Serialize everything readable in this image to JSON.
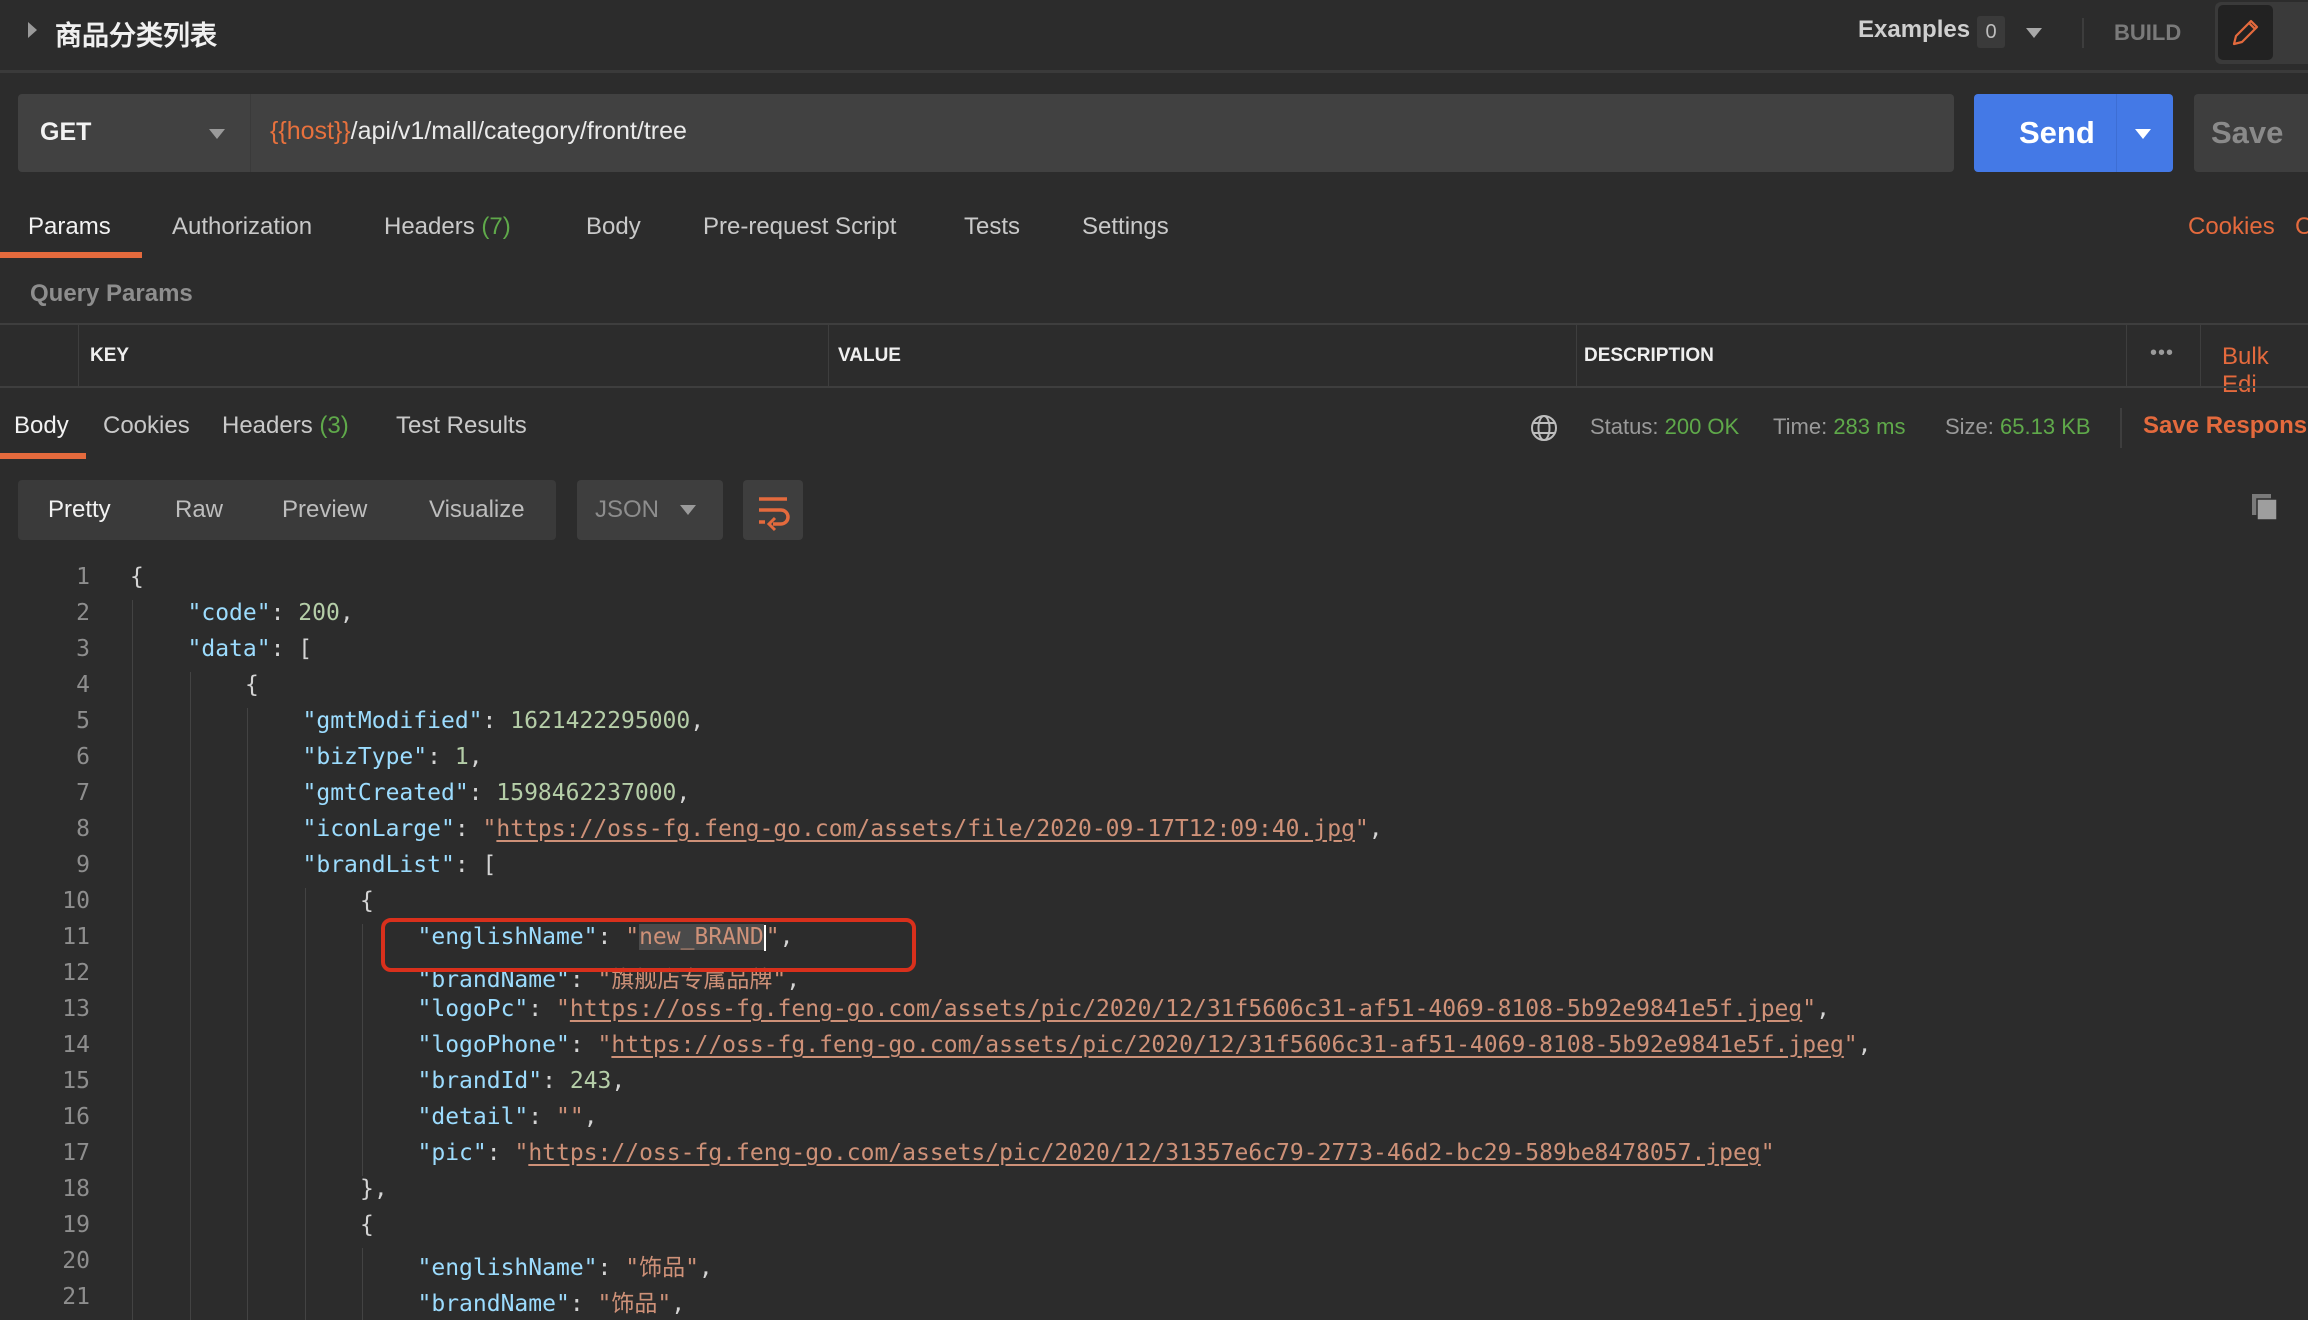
{
  "header": {
    "title": "商品分类列表",
    "examples_label": "Examples",
    "examples_count": "0",
    "build_label": "BUILD"
  },
  "request": {
    "method": "GET",
    "url_variable": "{{host}}",
    "url_path": "/api/v1/mall/category/front/tree",
    "send_label": "Send",
    "save_label": "Save"
  },
  "request_tabs": [
    {
      "label": "Params",
      "count": "",
      "active": true
    },
    {
      "label": "Authorization",
      "count": ""
    },
    {
      "label": "Headers",
      "count": "(7)"
    },
    {
      "label": "Body",
      "count": ""
    },
    {
      "label": "Pre-request Script",
      "count": ""
    },
    {
      "label": "Tests",
      "count": ""
    },
    {
      "label": "Settings",
      "count": ""
    }
  ],
  "request_links": {
    "cookies": "Cookies",
    "code": "C"
  },
  "query_params": {
    "title": "Query Params",
    "columns": [
      "KEY",
      "VALUE",
      "DESCRIPTION"
    ],
    "more": "•••",
    "bulk_edit": "Bulk Edi"
  },
  "response": {
    "tabs": [
      {
        "label": "Body",
        "count": "",
        "active": true
      },
      {
        "label": "Cookies",
        "count": ""
      },
      {
        "label": "Headers",
        "count": "(3)"
      },
      {
        "label": "Test Results",
        "count": ""
      }
    ],
    "status_label": "Status:",
    "status_value": "200 OK",
    "time_label": "Time:",
    "time_value": "283 ms",
    "size_label": "Size:",
    "size_value": "65.13 KB",
    "save_response": "Save Response",
    "view_modes": [
      "Pretty",
      "Raw",
      "Preview",
      "Visualize"
    ],
    "active_view": "Pretty",
    "format": "JSON"
  },
  "code_lines": [
    {
      "n": "1",
      "indent": 0,
      "parts": [
        [
          "p",
          "{"
        ]
      ]
    },
    {
      "n": "2",
      "indent": 1,
      "parts": [
        [
          "k",
          "\"code\""
        ],
        [
          "p",
          ": "
        ],
        [
          "n",
          "200"
        ],
        [
          "p",
          ","
        ]
      ]
    },
    {
      "n": "3",
      "indent": 1,
      "parts": [
        [
          "k",
          "\"data\""
        ],
        [
          "p",
          ": ["
        ]
      ]
    },
    {
      "n": "4",
      "indent": 2,
      "parts": [
        [
          "p",
          "{"
        ]
      ]
    },
    {
      "n": "5",
      "indent": 3,
      "parts": [
        [
          "k",
          "\"gmtModified\""
        ],
        [
          "p",
          ": "
        ],
        [
          "n",
          "1621422295000"
        ],
        [
          "p",
          ","
        ]
      ]
    },
    {
      "n": "6",
      "indent": 3,
      "parts": [
        [
          "k",
          "\"bizType\""
        ],
        [
          "p",
          ": "
        ],
        [
          "n",
          "1"
        ],
        [
          "p",
          ","
        ]
      ]
    },
    {
      "n": "7",
      "indent": 3,
      "parts": [
        [
          "k",
          "\"gmtCreated\""
        ],
        [
          "p",
          ": "
        ],
        [
          "n",
          "1598462237000"
        ],
        [
          "p",
          ","
        ]
      ]
    },
    {
      "n": "8",
      "indent": 3,
      "parts": [
        [
          "k",
          "\"iconLarge\""
        ],
        [
          "p",
          ": "
        ],
        [
          "s",
          "\""
        ],
        [
          "u",
          "https://oss-fg.feng-go.com/assets/file/2020-09-17T12:09:40.jpg"
        ],
        [
          "s",
          "\""
        ],
        [
          "p",
          ","
        ]
      ]
    },
    {
      "n": "9",
      "indent": 3,
      "parts": [
        [
          "k",
          "\"brandList\""
        ],
        [
          "p",
          ": ["
        ]
      ]
    },
    {
      "n": "10",
      "indent": 4,
      "parts": [
        [
          "p",
          "{"
        ]
      ]
    },
    {
      "n": "11",
      "indent": 5,
      "parts": [
        [
          "k",
          "\"englishName\""
        ],
        [
          "p",
          ": "
        ],
        [
          "s",
          "\""
        ],
        [
          "sel",
          "new_BRAND"
        ],
        [
          "cursor",
          ""
        ],
        [
          "s",
          "\""
        ],
        [
          "p",
          ","
        ]
      ]
    },
    {
      "n": "12",
      "indent": 5,
      "parts": [
        [
          "k",
          "\"brandName\""
        ],
        [
          "p",
          ": "
        ],
        [
          "s",
          "\"旗舰店专属品牌\""
        ],
        [
          "p",
          ","
        ]
      ]
    },
    {
      "n": "13",
      "indent": 5,
      "parts": [
        [
          "k",
          "\"logoPc\""
        ],
        [
          "p",
          ": "
        ],
        [
          "s",
          "\""
        ],
        [
          "u",
          "https://oss-fg.feng-go.com/assets/pic/2020/12/31f5606c31-af51-4069-8108-5b92e9841e5f.jpeg"
        ],
        [
          "s",
          "\""
        ],
        [
          "p",
          ","
        ]
      ]
    },
    {
      "n": "14",
      "indent": 5,
      "parts": [
        [
          "k",
          "\"logoPhone\""
        ],
        [
          "p",
          ": "
        ],
        [
          "s",
          "\""
        ],
        [
          "u",
          "https://oss-fg.feng-go.com/assets/pic/2020/12/31f5606c31-af51-4069-8108-5b92e9841e5f.jpeg"
        ],
        [
          "s",
          "\""
        ],
        [
          "p",
          ","
        ]
      ]
    },
    {
      "n": "15",
      "indent": 5,
      "parts": [
        [
          "k",
          "\"brandId\""
        ],
        [
          "p",
          ": "
        ],
        [
          "n",
          "243"
        ],
        [
          "p",
          ","
        ]
      ]
    },
    {
      "n": "16",
      "indent": 5,
      "parts": [
        [
          "k",
          "\"detail\""
        ],
        [
          "p",
          ": "
        ],
        [
          "s",
          "\"\""
        ],
        [
          "p",
          ","
        ]
      ]
    },
    {
      "n": "17",
      "indent": 5,
      "parts": [
        [
          "k",
          "\"pic\""
        ],
        [
          "p",
          ": "
        ],
        [
          "s",
          "\""
        ],
        [
          "u",
          "https://oss-fg.feng-go.com/assets/pic/2020/12/31357e6c79-2773-46d2-bc29-589be8478057.jpeg"
        ],
        [
          "s",
          "\""
        ]
      ]
    },
    {
      "n": "18",
      "indent": 4,
      "parts": [
        [
          "p",
          "},"
        ]
      ]
    },
    {
      "n": "19",
      "indent": 4,
      "parts": [
        [
          "p",
          "{"
        ]
      ]
    },
    {
      "n": "20",
      "indent": 5,
      "parts": [
        [
          "k",
          "\"englishName\""
        ],
        [
          "p",
          ": "
        ],
        [
          "s",
          "\"饰品\""
        ],
        [
          "p",
          ","
        ]
      ]
    },
    {
      "n": "21",
      "indent": 5,
      "parts": [
        [
          "k",
          "\"brandName\""
        ],
        [
          "p",
          ": "
        ],
        [
          "s",
          "\"饰品\""
        ],
        [
          "p",
          ","
        ]
      ]
    }
  ],
  "colors": {
    "accent": "#e46a3d",
    "send_blue": "#4479e6",
    "status_green": "#5fa94a",
    "highlight_box": "#d9301c"
  }
}
